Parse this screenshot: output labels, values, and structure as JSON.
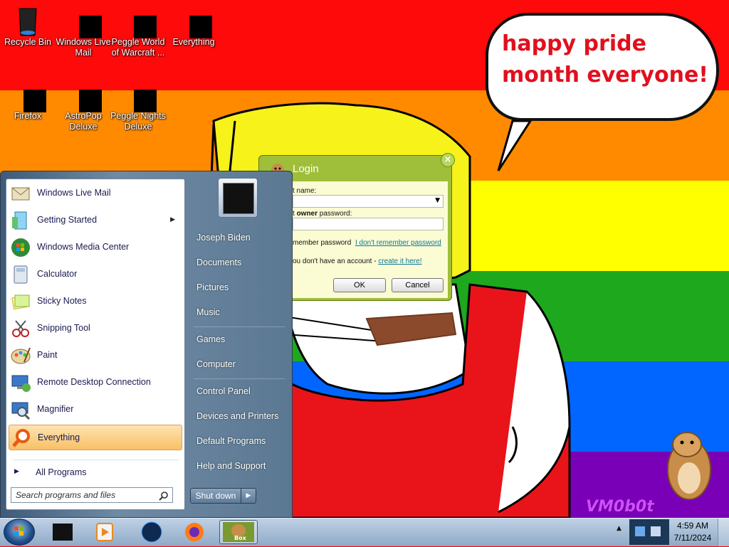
{
  "desktop": {
    "icons": [
      {
        "label": "Recycle Bin"
      },
      {
        "label": "Windows Live Mail"
      },
      {
        "label": "Peggle World of Warcraft ..."
      },
      {
        "label": "Everything"
      },
      {
        "label": "Firefox"
      },
      {
        "label": "AstroPop Deluxe"
      },
      {
        "label": "Peggle Nights Deluxe"
      }
    ],
    "speech_bubble": "happy pride month everyone!",
    "watermark": "VM0b0t"
  },
  "login_dialog": {
    "title": "Login",
    "account_label": "t name:",
    "password_label_prefix": "t ",
    "password_label_bold": "owner",
    "password_label_suffix": " password:",
    "remember_label": "member password",
    "forgot_link": "I don't remember password",
    "no_account_text": "ou don't have an account - ",
    "create_link": "create it here!",
    "ok_label": "OK",
    "cancel_label": "Cancel",
    "close_glyph": "×"
  },
  "start_menu": {
    "programs": [
      {
        "label": "Windows Live Mail"
      },
      {
        "label": "Getting Started"
      },
      {
        "label": "Windows Media Center"
      },
      {
        "label": "Calculator"
      },
      {
        "label": "Sticky Notes"
      },
      {
        "label": "Snipping Tool"
      },
      {
        "label": "Paint"
      },
      {
        "label": "Remote Desktop Connection"
      },
      {
        "label": "Magnifier"
      },
      {
        "label": "Everything"
      }
    ],
    "all_programs": "All Programs",
    "search_placeholder": "Search programs and files",
    "right_items": [
      {
        "label": "Joseph Biden"
      },
      {
        "label": "Documents"
      },
      {
        "label": "Pictures"
      },
      {
        "label": "Music"
      },
      {
        "label": "Games"
      },
      {
        "label": "Computer"
      },
      {
        "label": "Control Panel"
      },
      {
        "label": "Devices and Printers"
      },
      {
        "label": "Default Programs"
      },
      {
        "label": "Help and Support"
      }
    ],
    "shutdown_label": "Shut down"
  },
  "taskbar": {
    "time": "4:59 AM",
    "date": "7/11/2024",
    "active_app_label": "Box"
  },
  "colors": {
    "bubble_text": "#e1101e",
    "dialog_frame": "#9fbe3a",
    "highlight": "#f8c066"
  }
}
